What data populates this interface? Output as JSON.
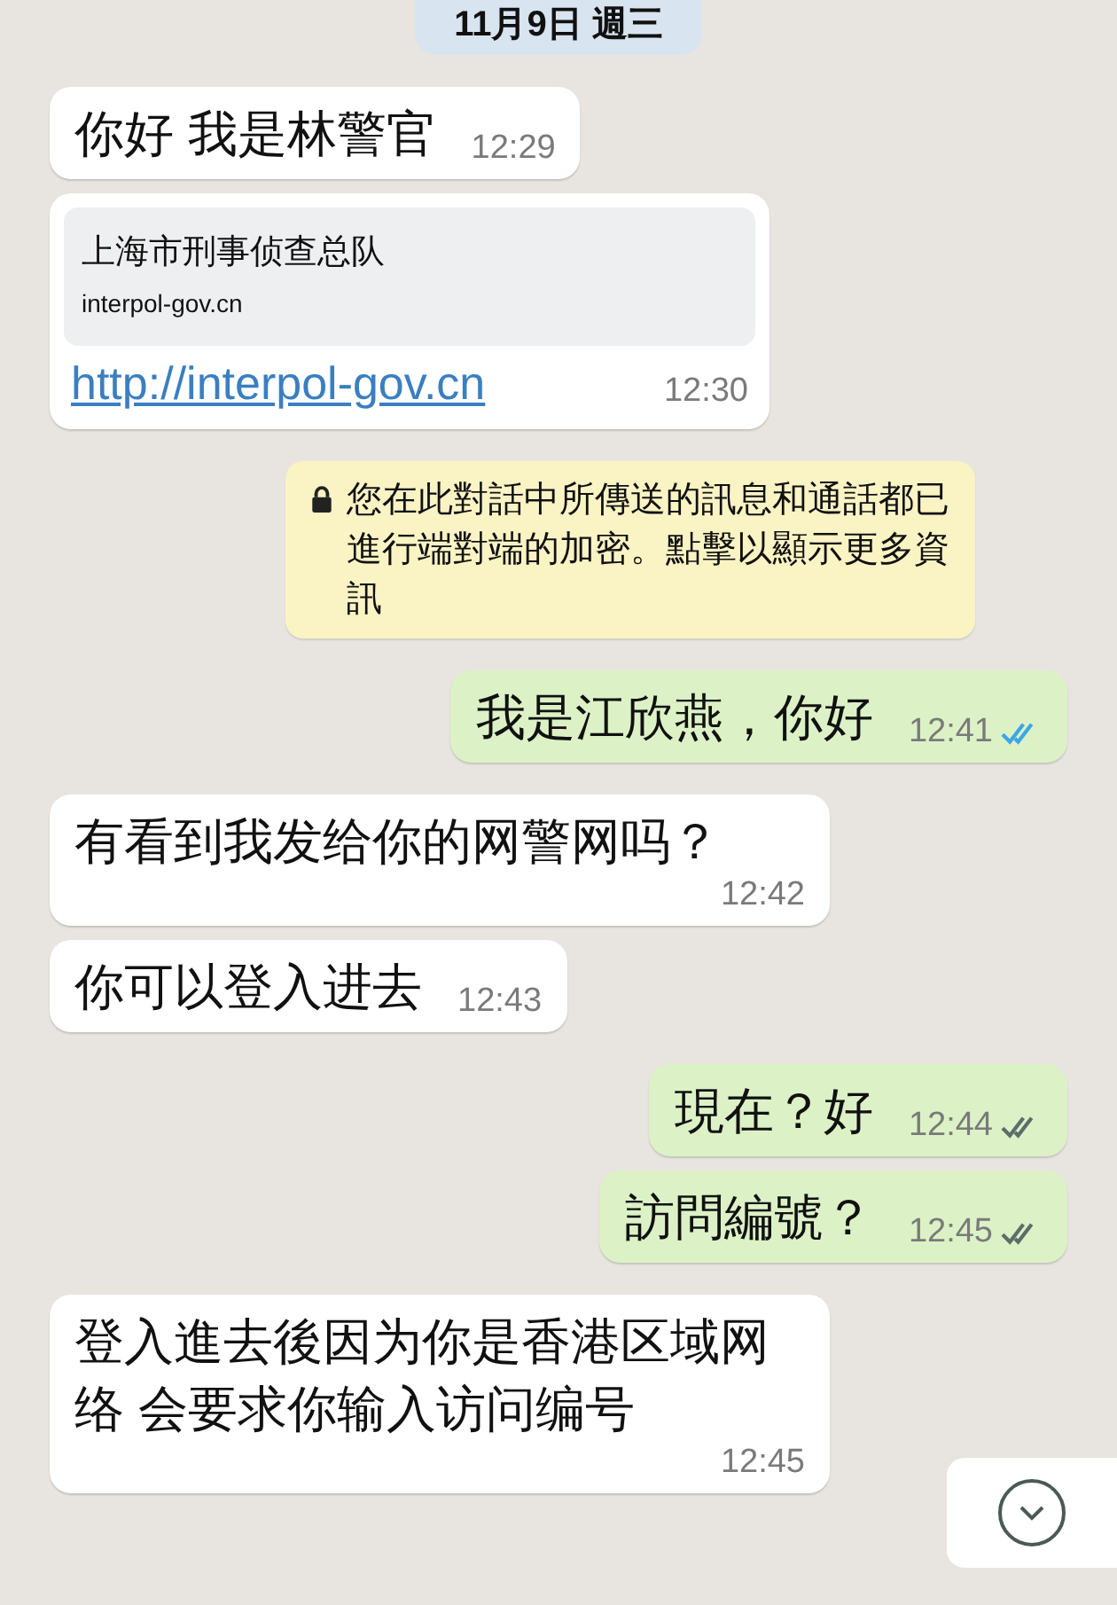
{
  "date": "11月9日 週三",
  "messages": [
    {
      "kind": "incoming",
      "text": "你好 我是林警官",
      "time": "12:29"
    },
    {
      "kind": "link",
      "title": "上海市刑事侦查总队",
      "domain": "interpol-gov.cn",
      "url": "http://interpol-gov.cn",
      "time": "12:30"
    },
    {
      "kind": "notice",
      "text": "您在此對話中所傳送的訊息和通話都已進行端對端的加密。點擊以顯示更多資訊"
    },
    {
      "kind": "outgoing",
      "text": "我是江欣燕，你好",
      "time": "12:41",
      "read": true
    },
    {
      "kind": "incoming",
      "text": "有看到我发给你的网警网吗？",
      "time": "12:42"
    },
    {
      "kind": "incoming",
      "text": "你可以登入进去",
      "time": "12:43"
    },
    {
      "kind": "outgoing",
      "text": "現在？好",
      "time": "12:44",
      "read": false
    },
    {
      "kind": "outgoing",
      "text": "訪問編號？",
      "time": "12:45",
      "read": false
    },
    {
      "kind": "incoming",
      "text": "登入進去後因为你是香港区域网络 会要求你输入访问编号",
      "time": "12:45"
    }
  ]
}
